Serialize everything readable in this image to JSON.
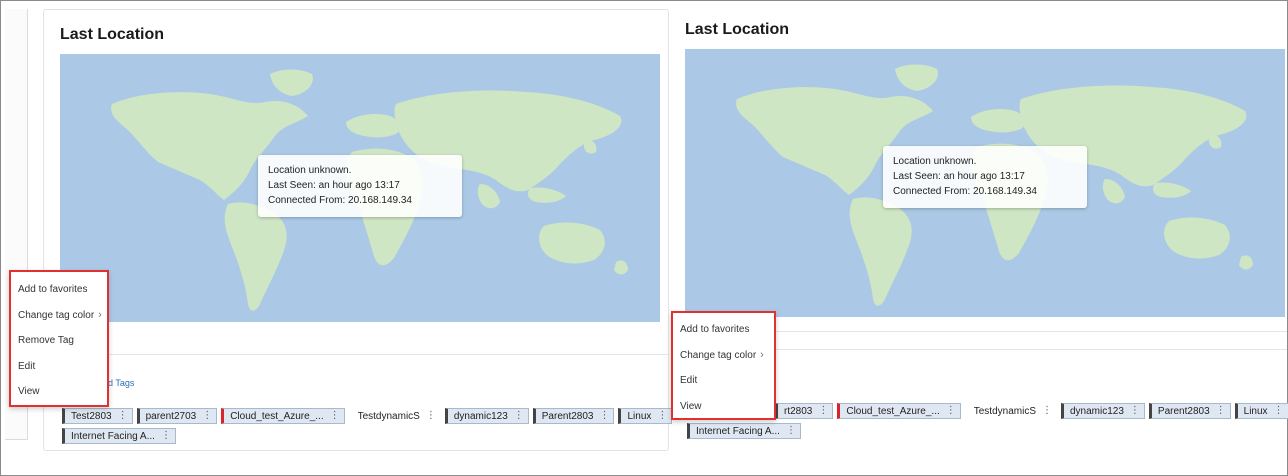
{
  "left": {
    "title": "Last Location",
    "tooltip": {
      "line1": "Location unknown.",
      "line2": "Last Seen: an hour ago 13:17",
      "line3": "Connected From: 20.168.149.34"
    },
    "tags_link": "d Tags",
    "tags_row1": [
      {
        "label": "Test2803",
        "style": "dark"
      },
      {
        "label": "parent2703",
        "style": "dark"
      },
      {
        "label": "Cloud_test_Azure_...",
        "style": "red"
      },
      {
        "label": "TestdynamicS",
        "style": "plain"
      },
      {
        "label": "dynamic123",
        "style": "dark"
      },
      {
        "label": "Parent2803",
        "style": "dark"
      },
      {
        "label": "Linux",
        "style": "dark"
      }
    ],
    "tags_row2": [
      {
        "label": "Internet Facing A...",
        "style": "dark"
      }
    ],
    "context_menu": {
      "items": [
        "Add to favorites",
        "Change tag color",
        "Remove Tag",
        "Edit",
        "View"
      ]
    }
  },
  "right": {
    "title": "Last Location",
    "tooltip": {
      "line1": "Location unknown.",
      "line2": "Last Seen: an hour ago 13:17",
      "line3": "Connected From: 20.168.149.34"
    },
    "tags_row1": [
      {
        "label": "rt2803",
        "style": "dark"
      },
      {
        "label": "Cloud_test_Azure_...",
        "style": "red"
      },
      {
        "label": "TestdynamicS",
        "style": "plain"
      },
      {
        "label": "dynamic123",
        "style": "dark"
      },
      {
        "label": "Parent2803",
        "style": "dark"
      },
      {
        "label": "Linux",
        "style": "dark"
      }
    ],
    "tags_row2": [
      {
        "label": "Internet Facing A...",
        "style": "dark"
      }
    ],
    "context_menu": {
      "items": [
        "Add to favorites",
        "Change tag color",
        "Edit",
        "View"
      ]
    }
  },
  "icons": {
    "kebab": "kebab-icon",
    "chevron": "chevron-right-icon"
  },
  "colors": {
    "map_water": "#abc9e6",
    "map_land": "#cfe6c4",
    "highlight": "#e03030",
    "tag_red": "#d9232d"
  }
}
